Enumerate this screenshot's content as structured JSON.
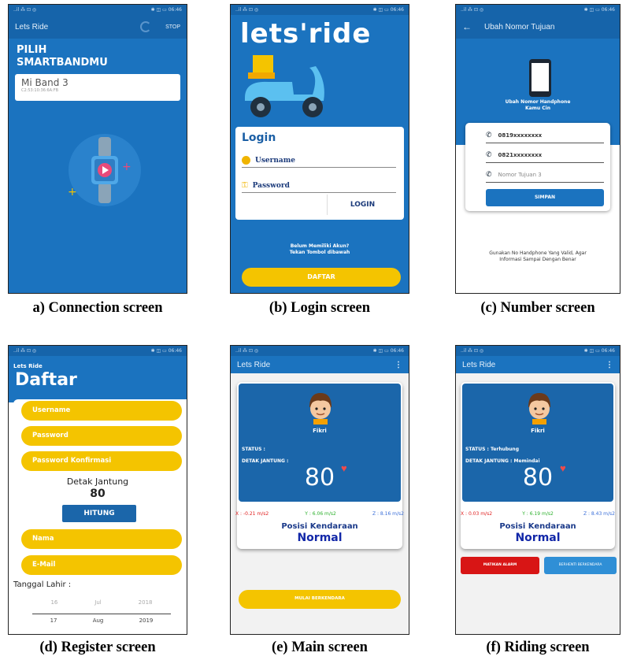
{
  "captions": {
    "a": "a) Connection screen",
    "b": "(b) Login screen",
    "c": "(c) Number screen",
    "d": "(d) Register screen",
    "e": "(e) Main screen",
    "f": "(f) Riding screen"
  },
  "status_bar": {
    "left": "..il ⁂ ⊡ ◎",
    "right": "✱ ◫ ▭ 06:46"
  },
  "connection": {
    "app_title": "Lets Ride",
    "stop_label": "STOP",
    "heading_line1": "PILIH",
    "heading_line2": "SMARTBANDMU",
    "device_name": "Mi Band 3",
    "device_mac": "C2:53:10:36:6A:FB"
  },
  "login": {
    "logo": "lets'ride",
    "title": "Login",
    "username_label": "Username",
    "password_label": "Password",
    "login_button": "LOGIN",
    "no_account_line1": "Belum Memiliki Akun?",
    "no_account_line2": "Tekan Tombol dibawah",
    "register_button": "DAFTAR"
  },
  "number": {
    "app_title": "Ubah Nomor Tujuan",
    "heading_line1": "Ubah Nomor Handphone",
    "heading_line2": "Kamu Cin",
    "numbers": [
      "0819xxxxxxxx",
      "0821xxxxxxxx"
    ],
    "third_placeholder": "Nomor Tujuan 3",
    "save_button": "SIMPAN",
    "note_line1": "Gunakan No Handphone Yang Valid, Agar",
    "note_line2": "Informasi Sampai Dengan Benar"
  },
  "register": {
    "small_title": "Lets Ride",
    "title": "Daftar",
    "fields": [
      "Username",
      "Password",
      "Password Konfirmasi"
    ],
    "heart_label": "Detak Jantung",
    "heart_value": "80",
    "count_button": "HITUNG",
    "fields2": [
      "Nama",
      "E-Mail"
    ],
    "birth_label": "Tanggal Lahir :",
    "date_prev": [
      "16",
      "Jul",
      "2018"
    ],
    "date_current": [
      "17",
      "Aug",
      "2019"
    ]
  },
  "main": {
    "app_title": "Lets Ride",
    "name": "Fikri",
    "status_label": "STATUS :",
    "heart_label": "DETAK JANTUNG :",
    "heart_value": "80",
    "accel_x": "X : -0.21 m/s2",
    "accel_y": "Y : 6.06 m/s2",
    "accel_z": "Z : 8.16 m/s2",
    "position_label": "Posisi Kendaraan",
    "position_value": "Normal",
    "start_button": "MULAI BERKENDARA"
  },
  "riding": {
    "app_title": "Lets Ride",
    "name": "Fikri",
    "status_label": "STATUS : Terhubung",
    "heart_label": "DETAK JANTUNG : Memindai",
    "heart_value": "80",
    "accel_x": "X : 0.03 m/s2",
    "accel_y": "Y : 6.19 m/s2",
    "accel_z": "Z : 8.43 m/s2",
    "position_label": "Posisi Kendaraan",
    "position_value": "Normal",
    "alarm_button": "MATIKAN ALARM",
    "stop_button": "BERHENTI BERKENDARA"
  },
  "colors": {
    "blue": "#1b66aa",
    "dark_blue": "#0f5fa8",
    "yellow": "#f4c400",
    "red": "#d81515",
    "light_blue": "#2f8fd6"
  }
}
